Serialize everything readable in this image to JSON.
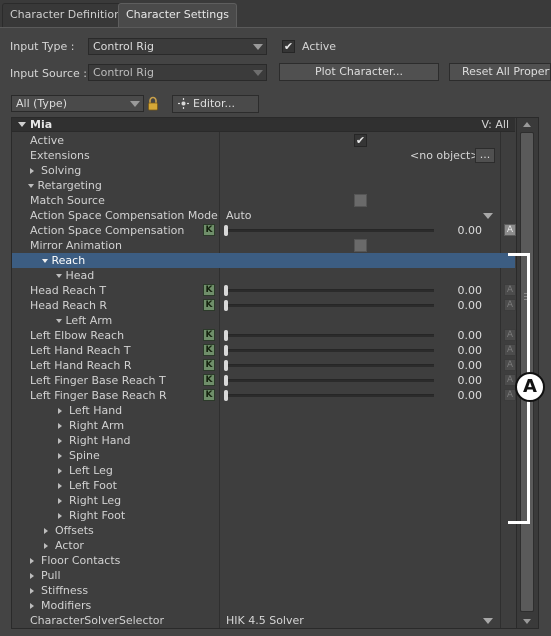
{
  "tabs": [
    {
      "label": "Character Definition",
      "active": false
    },
    {
      "label": "Character Settings",
      "active": true
    }
  ],
  "form": {
    "input_type_label": "Input Type :",
    "input_type_value": "Control Rig",
    "active_label": "Active",
    "input_source_label": "Input Source :",
    "input_source_value": "Control Rig",
    "plot_button": "Plot Character...",
    "reset_button": "Reset All Properties"
  },
  "filter": {
    "type_value": "All (Type)",
    "editor_button": "Editor..."
  },
  "panel": {
    "header_title": "Mia",
    "header_view": "V: All",
    "rows": [
      {
        "label": "Active"
      },
      {
        "label": "Extensions",
        "value": "<no object>",
        "button": "..."
      },
      {
        "label": "Solving"
      },
      {
        "label": "Retargeting"
      },
      {
        "label": "Match Source"
      },
      {
        "label": "Action Space Compensation Mode",
        "value": "Auto"
      },
      {
        "label": "Action Space Compensation",
        "k": "K",
        "value": "0.00",
        "a": "A"
      },
      {
        "label": "Mirror Animation"
      },
      {
        "label": "Reach"
      },
      {
        "label": "Head"
      },
      {
        "label": "Head Reach T",
        "k": "K",
        "value": "0.00",
        "a": "A"
      },
      {
        "label": "Head Reach R",
        "k": "K",
        "value": "0.00",
        "a": "A"
      },
      {
        "label": "Left Arm"
      },
      {
        "label": "Left Elbow Reach",
        "k": "K",
        "value": "0.00",
        "a": "A"
      },
      {
        "label": "Left Hand Reach T",
        "k": "K",
        "value": "0.00",
        "a": "A"
      },
      {
        "label": "Left Hand Reach R",
        "k": "K",
        "value": "0.00",
        "a": "A"
      },
      {
        "label": "Left Finger Base Reach T",
        "k": "K",
        "value": "0.00",
        "a": "A"
      },
      {
        "label": "Left Finger Base Reach R",
        "k": "K",
        "value": "0.00",
        "a": "A"
      },
      {
        "label": "Left Hand"
      },
      {
        "label": "Right Arm"
      },
      {
        "label": "Right Hand"
      },
      {
        "label": "Spine"
      },
      {
        "label": "Left Leg"
      },
      {
        "label": "Left Foot"
      },
      {
        "label": "Right Leg"
      },
      {
        "label": "Right Foot"
      },
      {
        "label": "Offsets"
      },
      {
        "label": "Actor"
      },
      {
        "label": "Floor Contacts"
      },
      {
        "label": "Pull"
      },
      {
        "label": "Stiffness"
      },
      {
        "label": "Modifiers"
      },
      {
        "label": "CharacterSolverSelector",
        "value": "HIK 4.5 Solver"
      }
    ]
  },
  "callout_letter": "A",
  "checkmark": "✔"
}
